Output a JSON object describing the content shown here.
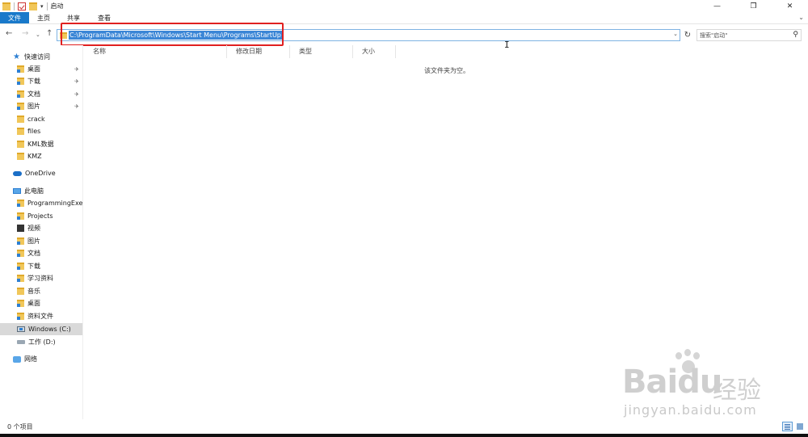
{
  "window": {
    "title": "启动",
    "controls": {
      "minimize": "—",
      "maximize": "❐",
      "close": "✕"
    }
  },
  "quick_access_toolbar": {
    "dropdown_arrow": "▾"
  },
  "ribbon": {
    "tabs": [
      {
        "label": "文件",
        "active": true
      },
      {
        "label": "主页"
      },
      {
        "label": "共享"
      },
      {
        "label": "查看"
      }
    ],
    "expand_icon": "⌄"
  },
  "navigation": {
    "back": "←",
    "forward": "→",
    "recent": "⌄",
    "up": "↑"
  },
  "address_bar": {
    "path": "C:\\ProgramData\\Microsoft\\Windows\\Start Menu\\Programs\\StartUp",
    "selected": true,
    "dropdown": "⌄",
    "refresh": "↻"
  },
  "search": {
    "placeholder": "搜索\"启动\"",
    "icon": "⚲"
  },
  "sidebar": {
    "items": [
      {
        "label": "快速访问",
        "icon": "star-icon"
      },
      {
        "label": "桌面",
        "icon": "desktop-folder-icon",
        "pinned": true
      },
      {
        "label": "下载",
        "icon": "downloads-folder-icon",
        "pinned": true
      },
      {
        "label": "文档",
        "icon": "documents-folder-icon",
        "pinned": true
      },
      {
        "label": "图片",
        "icon": "pictures-folder-icon",
        "pinned": true
      },
      {
        "label": "crack",
        "icon": "folder-icon"
      },
      {
        "label": "files",
        "icon": "folder-icon"
      },
      {
        "label": "KML数据",
        "icon": "folder-icon"
      },
      {
        "label": "KMZ",
        "icon": "folder-icon"
      },
      {
        "label": "OneDrive",
        "icon": "cloud-icon"
      },
      {
        "label": "此电脑",
        "icon": "computer-icon"
      },
      {
        "label": "ProgrammingExer",
        "icon": "folder-icon"
      },
      {
        "label": "Projects",
        "icon": "folder-icon"
      },
      {
        "label": "视频",
        "icon": "videos-folder-icon"
      },
      {
        "label": "图片",
        "icon": "pictures-folder-icon"
      },
      {
        "label": "文档",
        "icon": "documents-folder-icon"
      },
      {
        "label": "下载",
        "icon": "downloads-folder-icon"
      },
      {
        "label": "学习资料",
        "icon": "folder-icon"
      },
      {
        "label": "音乐",
        "icon": "music-folder-icon"
      },
      {
        "label": "桌面",
        "icon": "desktop-folder-icon"
      },
      {
        "label": "资料文件",
        "icon": "folder-icon"
      },
      {
        "label": "Windows (C:)",
        "icon": "windows-drive-icon",
        "selected": true
      },
      {
        "label": "工作 (D:)",
        "icon": "drive-icon"
      },
      {
        "label": "网络",
        "icon": "network-icon"
      }
    ],
    "pin_glyph": "📌"
  },
  "columns": [
    "名称",
    "修改日期",
    "类型",
    "大小"
  ],
  "content": {
    "empty_message": "该文件夹为空。"
  },
  "status_bar": {
    "item_count": "0 个项目"
  },
  "watermark": {
    "logo": "Bai",
    "logo_tail": "du",
    "text": "经验",
    "url": "jingyan.baidu.com"
  },
  "colors": {
    "accent": "#1979ca",
    "selection": "#3b86d6",
    "highlight_box": "#e02020",
    "folder": "#f1c75a"
  }
}
